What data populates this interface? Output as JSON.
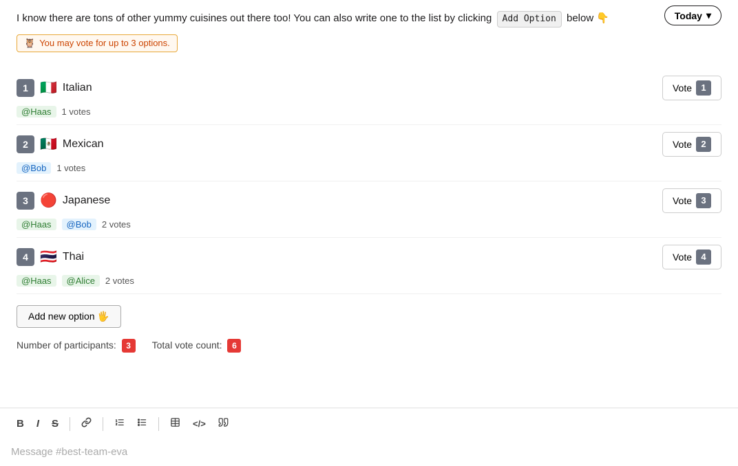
{
  "header": {
    "today_label": "Today",
    "chevron": "▾"
  },
  "intro": {
    "text": "I know there are tons of other yummy cuisines out there too! You can also write one to the list by clicking",
    "add_option_label": "Add Option",
    "below_text": "below",
    "pointing_emoji": "👇"
  },
  "notice": {
    "owl_emoji": "🦉",
    "text": "You may vote for up to 3 options."
  },
  "options": [
    {
      "number": "1",
      "flag": "🇮🇹",
      "name": "Italian",
      "vote_label": "Vote",
      "vote_number": "1",
      "voters": [
        "@Haas"
      ],
      "vote_count": "1 votes"
    },
    {
      "number": "2",
      "flag": "🇲🇽",
      "name": "Mexican",
      "vote_label": "Vote",
      "vote_number": "2",
      "voters": [
        "@Bob"
      ],
      "vote_count": "1 votes"
    },
    {
      "number": "3",
      "flag": "🔴",
      "name": "Japanese",
      "vote_label": "Vote",
      "vote_number": "3",
      "voters": [
        "@Haas",
        "@Bob"
      ],
      "vote_count": "2 votes"
    },
    {
      "number": "4",
      "flag": "🇹🇭",
      "name": "Thai",
      "vote_label": "Vote",
      "vote_number": "4",
      "voters": [
        "@Haas",
        "@Alice"
      ],
      "vote_count": "2 votes"
    }
  ],
  "add_option_btn": "Add new option",
  "stats": {
    "participants_label": "Number of participants:",
    "participants_count": "3",
    "votes_label": "Total vote count:",
    "votes_count": "6"
  },
  "toolbar": {
    "bold": "B",
    "italic": "I",
    "strikethrough": "S",
    "link": "🔗",
    "ol": "≡",
    "ul": "☰",
    "table": "⊞",
    "code": "</>",
    "quote": "❝"
  },
  "message_placeholder": "Message #best-team-eva"
}
